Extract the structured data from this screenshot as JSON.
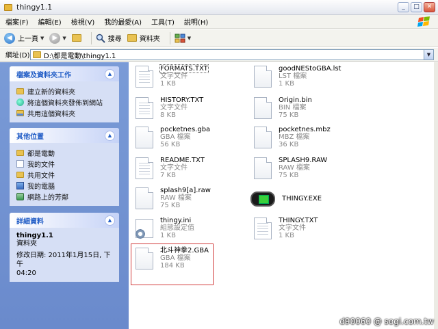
{
  "window": {
    "title": "thingy1.1",
    "minimize": "_",
    "maximize": "□",
    "close": "✕"
  },
  "menu": [
    "檔案(F)",
    "編輯(E)",
    "檢視(V)",
    "我的最愛(A)",
    "工具(T)",
    "說明(H)"
  ],
  "toolbar": {
    "back_label": "上一頁",
    "search_label": "搜尋",
    "folders_label": "資料夾"
  },
  "address": {
    "label": "網址(D)",
    "path": "D:\\都是電動\\thingy1.1"
  },
  "left": {
    "tasks_title": "檔案及資料夾工作",
    "tasks": [
      "建立新的資料夾",
      "將這個資料夾發佈到網站",
      "共用這個資料夾"
    ],
    "places_title": "其他位置",
    "places": [
      "都是電動",
      "我的文件",
      "共用文件",
      "我的電腦",
      "網路上的芳鄰"
    ],
    "details_title": "詳細資料",
    "details_name": "thingy1.1",
    "details_type": "資料夾",
    "details_modified_1": "修改日期: 2011年1月15日, 下午",
    "details_modified_2": "04:20"
  },
  "files": [
    {
      "name": "FORMATS.TXT",
      "type": "文字文件",
      "size": "1 KB",
      "icon": "text-file-icon"
    },
    {
      "name": "goodNEStoGBA.lst",
      "type": "LST 檔案",
      "size": "1 KB",
      "icon": "file-icon"
    },
    {
      "name": "HISTORY.TXT",
      "type": "文字文件",
      "size": "8 KB",
      "icon": "text-file-icon"
    },
    {
      "name": "Origin.bin",
      "type": "BIN 檔案",
      "size": "75 KB",
      "icon": "file-icon"
    },
    {
      "name": "pocketnes.gba",
      "type": "GBA 檔案",
      "size": "56 KB",
      "icon": "file-icon"
    },
    {
      "name": "pocketnes.mbz",
      "type": "MBZ 檔案",
      "size": "36 KB",
      "icon": "file-icon"
    },
    {
      "name": "README.TXT",
      "type": "文字文件",
      "size": "7 KB",
      "icon": "text-file-icon"
    },
    {
      "name": "SPLASH9.RAW",
      "type": "RAW 檔案",
      "size": "75 KB",
      "icon": "file-icon"
    },
    {
      "name": "splash9[a].raw",
      "type": "RAW 檔案",
      "size": "75 KB",
      "icon": "file-icon"
    },
    {
      "name": "THINGY.EXE",
      "type": "",
      "size": "",
      "icon": "gameboy-icon"
    },
    {
      "name": "thingy.ini",
      "type": "組態設定值",
      "size": "1 KB",
      "icon": "settings-file-icon"
    },
    {
      "name": "THINGY.TXT",
      "type": "文字文件",
      "size": "1 KB",
      "icon": "text-file-icon"
    },
    {
      "name": "北斗神拳2.GBA",
      "type": "GBA 檔案",
      "size": "184 KB",
      "icon": "file-icon"
    }
  ],
  "watermark": "d90060   @ sogi.com.tw"
}
